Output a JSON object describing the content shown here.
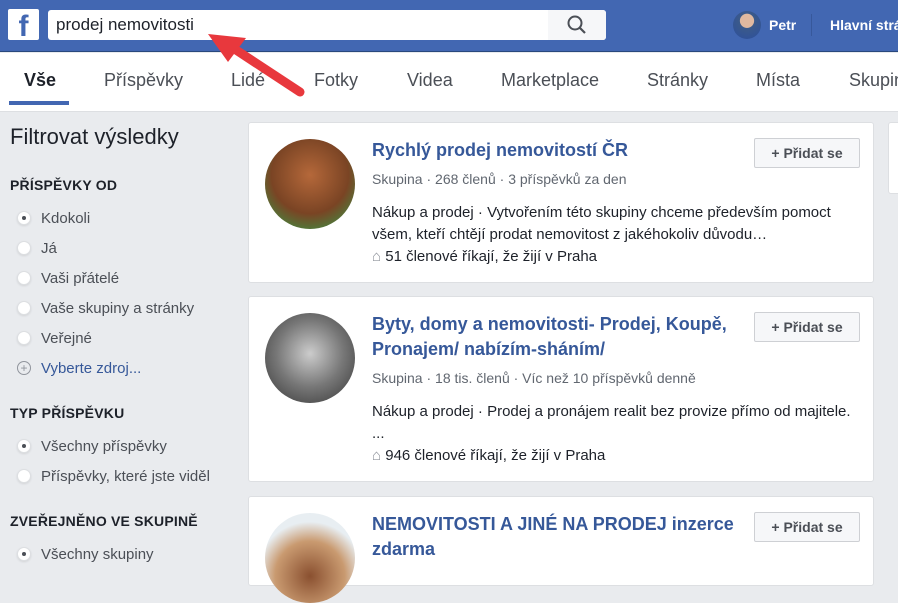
{
  "header": {
    "logo": "f",
    "search_value": "prodej nemovitosti",
    "user": "Petr",
    "home": "Hlavní stránka"
  },
  "tabs": [
    "Vše",
    "Příspěvky",
    "Lidé",
    "Fotky",
    "Videa",
    "Marketplace",
    "Stránky",
    "Místa",
    "Skupiny"
  ],
  "sidebar": {
    "title": "Filtrovat výsledky",
    "sections": [
      {
        "title": "PŘÍSPĚVKY OD",
        "options": [
          "Kdokoli",
          "Já",
          "Vaši přátelé",
          "Vaše skupiny a stránky",
          "Veřejné"
        ],
        "selected": 0,
        "more": "Vyberte zdroj..."
      },
      {
        "title": "TYP PŘÍSPĚVKU",
        "options": [
          "Všechny příspěvky",
          "Příspěvky, které jste viděl"
        ],
        "selected": 0
      },
      {
        "title": "ZVEŘEJNĚNO VE SKUPINĚ",
        "options": [
          "Všechny skupiny"
        ],
        "selected": 0
      }
    ]
  },
  "results": [
    {
      "title": "Rychlý prodej nemovitostí ČR",
      "meta": "Skupina · 268 členů · 3 příspěvků za den",
      "desc": "Nákup a prodej · Vytvořením této skupiny chceme především pomoct všem, kteří chtějí prodat nemovitost z jakéhokoliv důvodu…",
      "loc": "51 členové říkají, že žijí v Praha",
      "join": "Přidat se"
    },
    {
      "title": "Byty, domy a nemovitosti- Prodej, Koupě, Pronajem/ nabízím-sháním/",
      "meta": "Skupina · 18 tis. členů · Víc než 10 příspěvků denně",
      "desc": "Nákup a prodej · Prodej a pronájem realit bez provize přímo od majitele. ...",
      "loc": "946 členové říkají, že žijí v Praha",
      "join": "Přidat se"
    },
    {
      "title": "NEMOVITOSTI A JINÉ NA PRODEJ inzerce zdarma",
      "join": "Přidat se"
    }
  ],
  "colors": {
    "brand": "#4267b2",
    "link": "#365899",
    "arrow": "#e8383d"
  }
}
